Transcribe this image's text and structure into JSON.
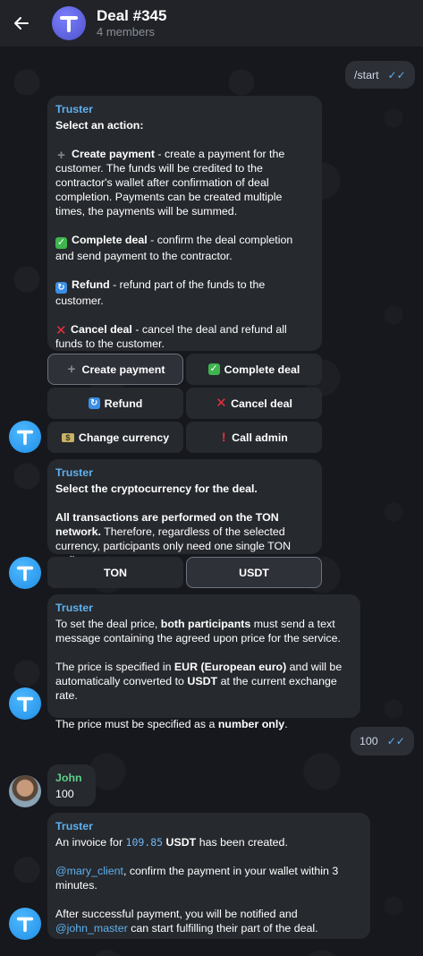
{
  "header": {
    "title": "Deal #345",
    "subtitle": "4 members"
  },
  "messages": {
    "start": "/start",
    "actions": {
      "sender": "Truster",
      "heading": "Select an action:",
      "create_label": "Create payment",
      "create_desc": " - create a payment for the customer. The funds will be credited to the contractor's wallet after confirmation of deal completion. Payments can be created multiple times, the payments will be summed.",
      "complete_label": "Complete deal",
      "complete_desc": " - confirm the deal completion and send payment to the contractor.",
      "refund_label": "Refund",
      "refund_desc": " - refund part of the funds to the customer.",
      "cancel_label": "Cancel deal",
      "cancel_desc": " - cancel the deal and refund all funds to the customer."
    },
    "crypto": {
      "sender": "Truster",
      "heading": "Select the cryptocurrency for the deal.",
      "network_bold": "All transactions are performed on the TON network.",
      "network_rest": " Therefore, regardless of the selected currency, participants only need one single TON wallet."
    },
    "price": {
      "sender": "Truster",
      "p1_a": "To set the deal price, ",
      "p1_b": "both participants",
      "p1_c": " must send a text message containing the agreed upon price for the service.",
      "p2_a": "The price is specified in ",
      "p2_b": "EUR (European euro)",
      "p2_c": " and will be automatically converted to ",
      "p2_d": "USDT",
      "p2_e": " at the current exchange rate.",
      "p3_a": "The price must be specified as a ",
      "p3_b": "number only",
      "p3_c": "."
    },
    "out_100": "100",
    "john": {
      "sender": "John",
      "text": "100"
    },
    "invoice": {
      "sender": "Truster",
      "p1_a": "An invoice for ",
      "amount": "109.85",
      "p1_b": " USDT",
      "p1_c": " has been created.",
      "mention1": "@mary_client",
      "p2": ", confirm the payment in your wallet within 3 minutes.",
      "p3_a": "After successful payment, you will be notified and ",
      "mention2": "@john_master",
      "p3_b": " can start fulfilling their part of the deal."
    }
  },
  "keyboard1": {
    "create_payment": "Create payment",
    "complete_deal": "Complete deal",
    "refund": "Refund",
    "cancel_deal": "Cancel deal",
    "change_currency": "Change currency",
    "call_admin": "Call admin"
  },
  "keyboard2": {
    "ton": "TON",
    "usdt": "USDT"
  },
  "colors": {
    "accent": "#5eb1f0",
    "bubble": "#26292e",
    "header": "#212329"
  }
}
